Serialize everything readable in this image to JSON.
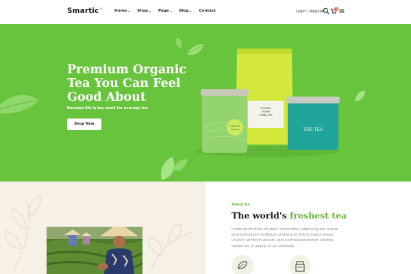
{
  "header": {
    "logo": "Smartic",
    "logo_mark": "°",
    "nav": [
      {
        "label": "Home",
        "caret": "▾"
      },
      {
        "label": "Shop",
        "caret": "▾"
      },
      {
        "label": "Page",
        "caret": "▾"
      },
      {
        "label": "Blog",
        "caret": "▾"
      },
      {
        "label": "Contact",
        "caret": ""
      }
    ],
    "login": "Login / Register",
    "cart_count": "0",
    "icons": [
      "search-icon",
      "cart-icon",
      "menu-icon"
    ]
  },
  "hero": {
    "title_lines": [
      "Premium Organic",
      "Tea You Can Feel",
      "Good About"
    ],
    "subtitle": "Because life is too short for average tea",
    "button": "Shop Now",
    "tin_label": "THE TEA",
    "pouch_label_lines": [
      "OOLONG",
      "FUJIAN",
      "CHINA TEA"
    ],
    "left_tin_label_lines": [
      "CAMELLIA",
      "SINENSIS"
    ],
    "colors": {
      "background": "#69c43d",
      "pouch": "#d3e83a",
      "teal_tin": "#1fa39a",
      "green_tin": "#8fd16a"
    }
  },
  "about": {
    "label": "About Us",
    "title_plain": "The world's ",
    "title_highlight": "freshest tea",
    "text": "Lorem ipsum dolor sit amet, consectetur adipisicing elit, sed do eiusmod tempor incididunt ut labore et dolore magna aliqua. Ut enim ad minim veniam, quis nostrud exercitation ullamco laboris nisi ut aliquip ex ea commodo.",
    "feature_icons": [
      "leaf-icon",
      "tea-tin-icon"
    ],
    "accent": "#62b830"
  }
}
